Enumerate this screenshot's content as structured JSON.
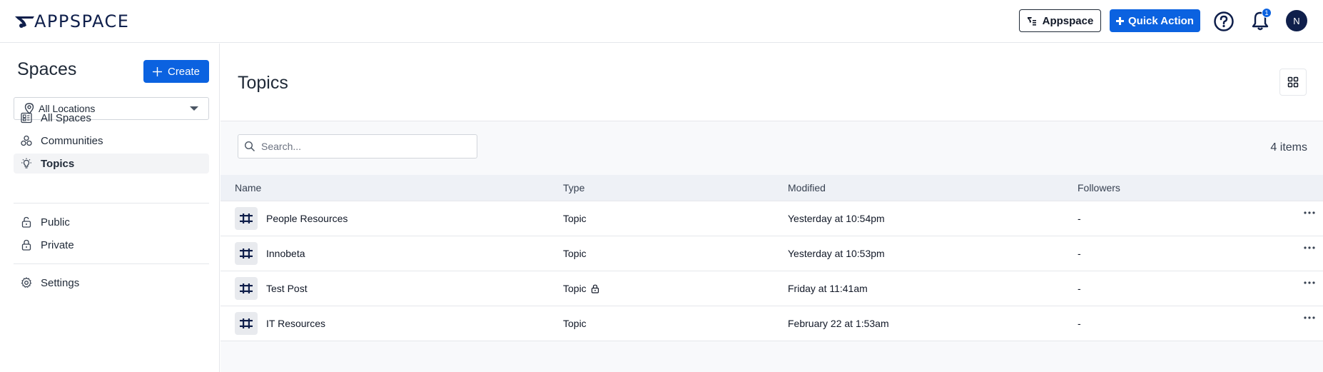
{
  "header": {
    "logo_text": "APPSPACE",
    "appspace_button": "Appspace",
    "quick_action_button": "Quick Action",
    "notification_count": "1",
    "avatar_initial": "N"
  },
  "sidebar": {
    "title": "Spaces",
    "create_button": "Create",
    "location_select": "All Locations",
    "items": [
      {
        "label": "All Spaces",
        "icon": "all-spaces-icon"
      },
      {
        "label": "Communities",
        "icon": "communities-icon"
      },
      {
        "label": "Topics",
        "icon": "lightbulb-icon",
        "active": true
      },
      {
        "label": "Public",
        "icon": "unlock-icon"
      },
      {
        "label": "Private",
        "icon": "lock-icon"
      },
      {
        "label": "Settings",
        "icon": "gear-icon"
      }
    ]
  },
  "main": {
    "title": "Topics",
    "search_placeholder": "Search...",
    "item_count": "4 items",
    "columns": [
      "Name",
      "Type",
      "Modified",
      "Followers"
    ],
    "rows": [
      {
        "name": "People Resources",
        "type": "Topic",
        "locked": false,
        "modified": "Yesterday at 10:54pm",
        "followers": "-"
      },
      {
        "name": "Innobeta",
        "type": "Topic",
        "locked": false,
        "modified": "Yesterday at 10:53pm",
        "followers": "-"
      },
      {
        "name": "Test Post",
        "type": "Topic",
        "locked": true,
        "modified": "Friday at 11:41am",
        "followers": "-"
      },
      {
        "name": "IT Resources",
        "type": "Topic",
        "locked": false,
        "modified": "February 22 at 1:53am",
        "followers": "-"
      }
    ]
  },
  "colors": {
    "accent": "#0b62e0",
    "navy": "#0f1f4b"
  }
}
